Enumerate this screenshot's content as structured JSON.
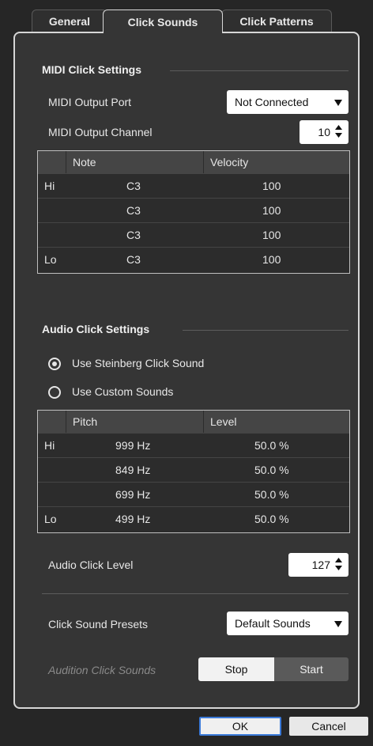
{
  "tabs": [
    "General",
    "Click Sounds",
    "Click Patterns"
  ],
  "midi": {
    "section_title": "MIDI Click Settings",
    "output_port_label": "MIDI Output Port",
    "output_port_value": "Not Connected",
    "output_channel_label": "MIDI Output Channel",
    "output_channel_value": "10",
    "table": {
      "headers": [
        "",
        "Note",
        "Velocity"
      ],
      "rows": [
        {
          "label": "Hi",
          "note": "C3",
          "velocity": "100"
        },
        {
          "label": "",
          "note": "C3",
          "velocity": "100"
        },
        {
          "label": "",
          "note": "C3",
          "velocity": "100"
        },
        {
          "label": "Lo",
          "note": "C3",
          "velocity": "100"
        }
      ]
    }
  },
  "audio": {
    "section_title": "Audio Click Settings",
    "radio_steinberg": "Use Steinberg Click Sound",
    "radio_custom": "Use Custom Sounds",
    "table": {
      "headers": [
        "",
        "Pitch",
        "Level"
      ],
      "rows": [
        {
          "label": "Hi",
          "pitch": "999 Hz",
          "level": "50.0 %"
        },
        {
          "label": "",
          "pitch": "849 Hz",
          "level": "50.0 %"
        },
        {
          "label": "",
          "pitch": "699 Hz",
          "level": "50.0 %"
        },
        {
          "label": "Lo",
          "pitch": "499 Hz",
          "level": "50.0 %"
        }
      ]
    },
    "click_level_label": "Audio Click Level",
    "click_level_value": "127"
  },
  "presets": {
    "label": "Click Sound Presets",
    "value": "Default Sounds"
  },
  "audition": {
    "label": "Audition Click Sounds",
    "stop": "Stop",
    "start": "Start"
  },
  "dialog": {
    "ok": "OK",
    "cancel": "Cancel"
  }
}
